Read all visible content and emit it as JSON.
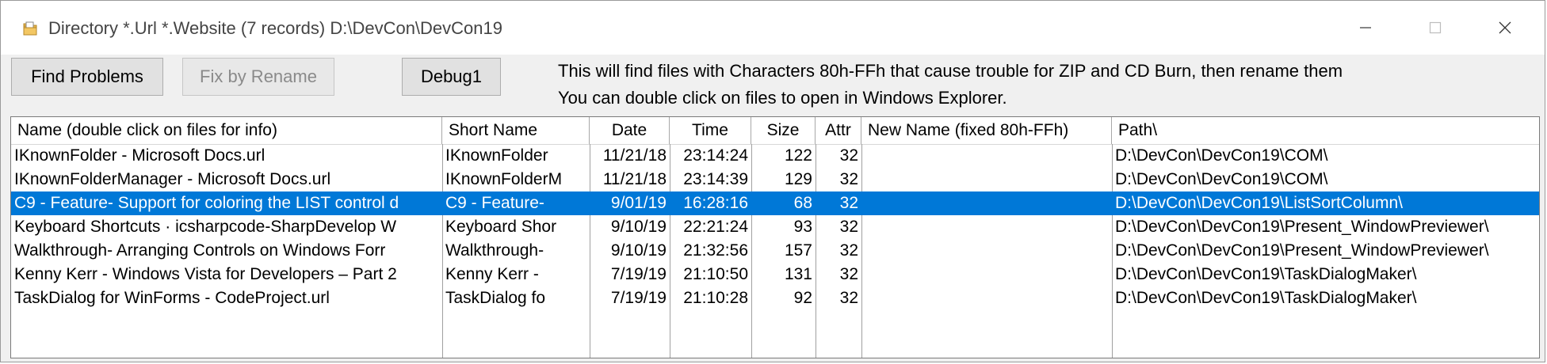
{
  "window": {
    "title": "Directory *.Url *.Website (7 records) D:\\DevCon\\DevCon19",
    "icon": "folder-icon"
  },
  "toolbar": {
    "find_problems": "Find Problems",
    "fix_by_rename": "Fix by Rename",
    "debug1": "Debug1",
    "info_line1": "This will find files with Characters 80h-FFh that cause trouble for ZIP and CD Burn, then rename them",
    "info_line2": "You can double click on files to open in Windows Explorer."
  },
  "table": {
    "headers": [
      "Name (double click on files for info)",
      "Short Name",
      "Date",
      "Time",
      "Size",
      "Attr",
      "New Name (fixed 80h-FFh)",
      "Path\\"
    ],
    "rows": [
      {
        "name": "IKnownFolder - Microsoft Docs.url",
        "short": "IKnownFolder",
        "date": "11/21/18",
        "time": "23:14:24",
        "size": "122",
        "attr": "32",
        "newname": "",
        "path": "D:\\DevCon\\DevCon19\\COM\\"
      },
      {
        "name": "IKnownFolderManager - Microsoft Docs.url",
        "short": "IKnownFolderM",
        "date": "11/21/18",
        "time": "23:14:39",
        "size": "129",
        "attr": "32",
        "newname": "",
        "path": "D:\\DevCon\\DevCon19\\COM\\"
      },
      {
        "name": "C9 - Feature- Support for coloring the LIST control d",
        "short": "C9 - Feature-",
        "date": "9/01/19",
        "time": "16:28:16",
        "size": "68",
        "attr": "32",
        "newname": "",
        "path": "D:\\DevCon\\DevCon19\\ListSortColumn\\",
        "selected": true
      },
      {
        "name": "Keyboard Shortcuts · icsharpcode-SharpDevelop W",
        "short": "Keyboard Shor",
        "date": "9/10/19",
        "time": "22:21:24",
        "size": "93",
        "attr": "32",
        "newname": "",
        "path": "D:\\DevCon\\DevCon19\\Present_WindowPreviewer\\"
      },
      {
        "name": "Walkthrough- Arranging Controls on Windows Forr",
        "short": "Walkthrough-",
        "date": "9/10/19",
        "time": "21:32:56",
        "size": "157",
        "attr": "32",
        "newname": "",
        "path": "D:\\DevCon\\DevCon19\\Present_WindowPreviewer\\"
      },
      {
        "name": "Kenny Kerr - Windows Vista for Developers – Part 2",
        "short": "Kenny Kerr -",
        "date": "7/19/19",
        "time": "21:10:50",
        "size": "131",
        "attr": "32",
        "newname": "",
        "path": "D:\\DevCon\\DevCon19\\TaskDialogMaker\\"
      },
      {
        "name": "TaskDialog for WinForms - CodeProject.url",
        "short": "TaskDialog fo",
        "date": "7/19/19",
        "time": "21:10:28",
        "size": "92",
        "attr": "32",
        "newname": "",
        "path": "D:\\DevCon\\DevCon19\\TaskDialogMaker\\"
      }
    ]
  },
  "colors": {
    "selection": "#0078d7"
  }
}
